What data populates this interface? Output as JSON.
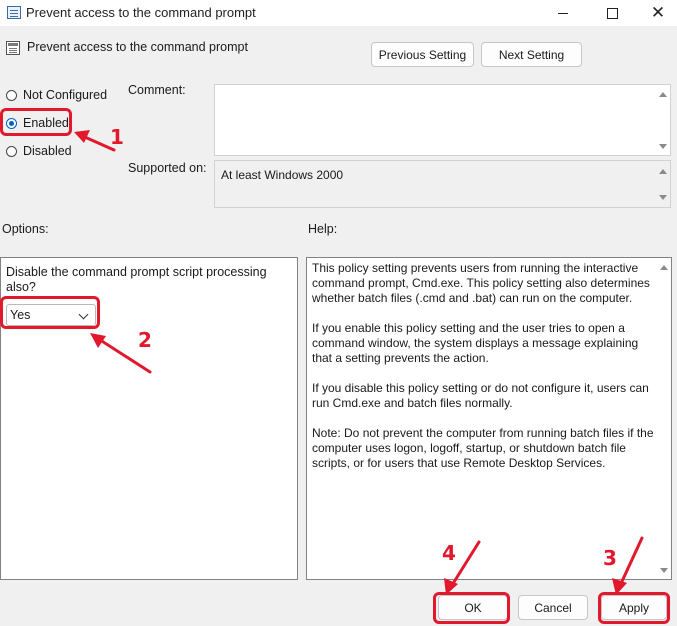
{
  "window": {
    "title": "Prevent access to the command prompt",
    "minimize_icon": "minimize-icon",
    "maximize_icon": "maximize-icon",
    "close_glyph": "✕"
  },
  "header": {
    "setting_title": "Prevent access to the command prompt",
    "prev_button": "Previous Setting",
    "next_button": "Next Setting"
  },
  "state": {
    "options": [
      {
        "label": "Not Configured",
        "selected": false
      },
      {
        "label": "Enabled",
        "selected": true
      },
      {
        "label": "Disabled",
        "selected": false
      }
    ]
  },
  "comment": {
    "label": "Comment:",
    "value": ""
  },
  "supported": {
    "label": "Supported on:",
    "value": "At least Windows 2000"
  },
  "options_section": {
    "label": "Options:",
    "prompt": "Disable the command prompt script processing also?",
    "select_value": "Yes"
  },
  "help_section": {
    "label": "Help:",
    "paragraphs": [
      "This policy setting prevents users from running the interactive command prompt, Cmd.exe.  This policy setting also determines whether batch files (.cmd and .bat) can run on the computer.",
      "If you enable this policy setting and the user tries to open a command window, the system displays a message explaining that a setting prevents the action.",
      "If you disable this policy setting or do not configure it, users can run Cmd.exe and batch files normally.",
      "Note: Do not prevent the computer from running batch files if the computer uses logon, logoff, startup, or shutdown batch file scripts, or for users that use Remote Desktop Services."
    ]
  },
  "footer": {
    "ok": "OK",
    "cancel": "Cancel",
    "apply": "Apply"
  },
  "annotations": {
    "n1": "1",
    "n2": "2",
    "n3": "3",
    "n4": "4"
  },
  "colors": {
    "annotation": "#e2192c",
    "radio_selected": "#0062c4"
  }
}
